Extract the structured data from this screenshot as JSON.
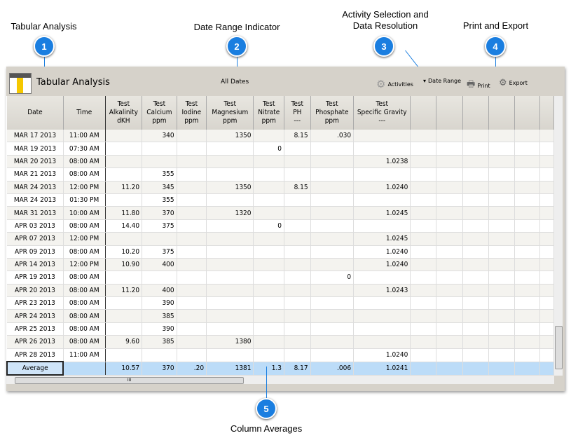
{
  "callouts": [
    {
      "num": "1",
      "label": "Tabular Analysis"
    },
    {
      "num": "2",
      "label": "Date Range Indicator"
    },
    {
      "num": "3",
      "label": "Activity Selection and Data Resolution"
    },
    {
      "num": "4",
      "label": "Print and Export"
    },
    {
      "num": "5",
      "label": "Column Averages"
    }
  ],
  "toolbar": {
    "title": "Tabular Analysis",
    "date_range": "All Dates",
    "activities": "Activities",
    "date_range_button": "Date Range",
    "print": "Print",
    "export": "Export"
  },
  "columns": [
    "Date",
    "Time",
    "Test\nAlkalinity\ndKH",
    "Test\nCalcium\nppm",
    "Test\nIodine\nppm",
    "Test\nMagnesium\nppm",
    "Test\nNitrate\nppm",
    "Test\nPH\n---",
    "Test\nPhosphate\nppm",
    "Test\nSpecific Gravity\n---",
    "",
    "",
    "",
    "",
    "",
    ""
  ],
  "rows": [
    [
      "MAR 17 2013",
      "11:00 AM",
      "",
      "340",
      "",
      "1350",
      "",
      "8.15",
      ".030",
      ""
    ],
    [
      "MAR 19 2013",
      "07:30 AM",
      "",
      "",
      "",
      "",
      "0",
      "",
      "",
      ""
    ],
    [
      "MAR 20 2013",
      "08:00 AM",
      "",
      "",
      "",
      "",
      "",
      "",
      "",
      "1.0238"
    ],
    [
      "MAR 21 2013",
      "08:00 AM",
      "",
      "355",
      "",
      "",
      "",
      "",
      "",
      ""
    ],
    [
      "MAR 24 2013",
      "12:00 PM",
      "11.20",
      "345",
      "",
      "1350",
      "",
      "8.15",
      "",
      "1.0240"
    ],
    [
      "MAR 24 2013",
      "01:30 PM",
      "",
      "355",
      "",
      "",
      "",
      "",
      "",
      ""
    ],
    [
      "MAR 31 2013",
      "10:00 AM",
      "11.80",
      "370",
      "",
      "1320",
      "",
      "",
      "",
      "1.0245"
    ],
    [
      "APR 03 2013",
      "08:00 AM",
      "14.40",
      "375",
      "",
      "",
      "0",
      "",
      "",
      ""
    ],
    [
      "APR 07 2013",
      "12:00 PM",
      "",
      "",
      "",
      "",
      "",
      "",
      "",
      "1.0245"
    ],
    [
      "APR 09 2013",
      "08:00 AM",
      "10.20",
      "375",
      "",
      "",
      "",
      "",
      "",
      "1.0240"
    ],
    [
      "APR 14 2013",
      "12:00 PM",
      "10.90",
      "400",
      "",
      "",
      "",
      "",
      "",
      "1.0240"
    ],
    [
      "APR 19 2013",
      "08:00 AM",
      "",
      "",
      "",
      "",
      "",
      "",
      "0",
      ""
    ],
    [
      "APR 20 2013",
      "08:00 AM",
      "11.20",
      "400",
      "",
      "",
      "",
      "",
      "",
      "1.0243"
    ],
    [
      "APR 23 2013",
      "08:00 AM",
      "",
      "390",
      "",
      "",
      "",
      "",
      "",
      ""
    ],
    [
      "APR 24 2013",
      "08:00 AM",
      "",
      "385",
      "",
      "",
      "",
      "",
      "",
      ""
    ],
    [
      "APR 25 2013",
      "08:00 AM",
      "",
      "390",
      "",
      "",
      "",
      "",
      "",
      ""
    ],
    [
      "APR 26 2013",
      "08:00 AM",
      "9.60",
      "385",
      "",
      "1380",
      "",
      "",
      "",
      ""
    ],
    [
      "APR 28 2013",
      "11:00 AM",
      "",
      "",
      "",
      "",
      "",
      "",
      "",
      "1.0240"
    ]
  ],
  "average": [
    "Average",
    "",
    "10.57",
    "370",
    ".20",
    "1381",
    "1.3",
    "8.17",
    ".006",
    "1.0241"
  ],
  "colors": {
    "callout": "#1a7ee0",
    "average_row": "#bcdcf8"
  }
}
